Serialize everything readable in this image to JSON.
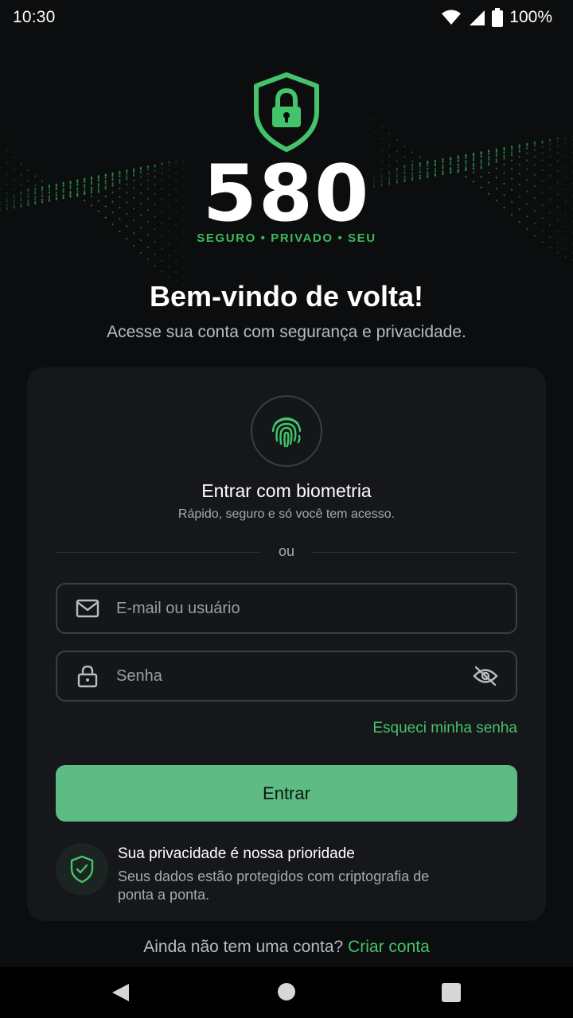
{
  "status_bar": {
    "time": "10:30",
    "battery": "100%",
    "icons": [
      "wifi-icon",
      "signal-icon",
      "battery-icon"
    ]
  },
  "logo": {
    "icon": "shield-lock-icon",
    "number": "580",
    "tagline": "SEGURO • PRIVADO • SEU"
  },
  "welcome": {
    "title": "Bem-vindo de volta!",
    "subtitle": "Acesse sua conta com segurança e privacidade."
  },
  "login_card": {
    "biometric": {
      "icon": "fingerprint-icon",
      "title": "Entrar com biometria",
      "subtitle": "Rápido, seguro e só você tem acesso."
    },
    "divider_text": "ou",
    "email_field": {
      "icon": "mail-icon",
      "placeholder": "E-mail ou usuário"
    },
    "password_field": {
      "icon": "lock-icon",
      "placeholder": "Senha",
      "toggle_icon": "eye-off-icon"
    },
    "forgot_password": "Esqueci minha senha",
    "submit_label": "Entrar",
    "privacy": {
      "icon": "shield-check-icon",
      "title": "Sua privacidade é nossa prioridade",
      "description": "Seus dados estão protegidos com criptografia de ponta a ponta."
    }
  },
  "signup": {
    "prompt": "Ainda não tem uma conta?",
    "link": "Criar conta"
  },
  "colors": {
    "accent": "#44c46a",
    "button": "#5dbb83",
    "background": "#0b0d0f",
    "card": "#15171a"
  }
}
